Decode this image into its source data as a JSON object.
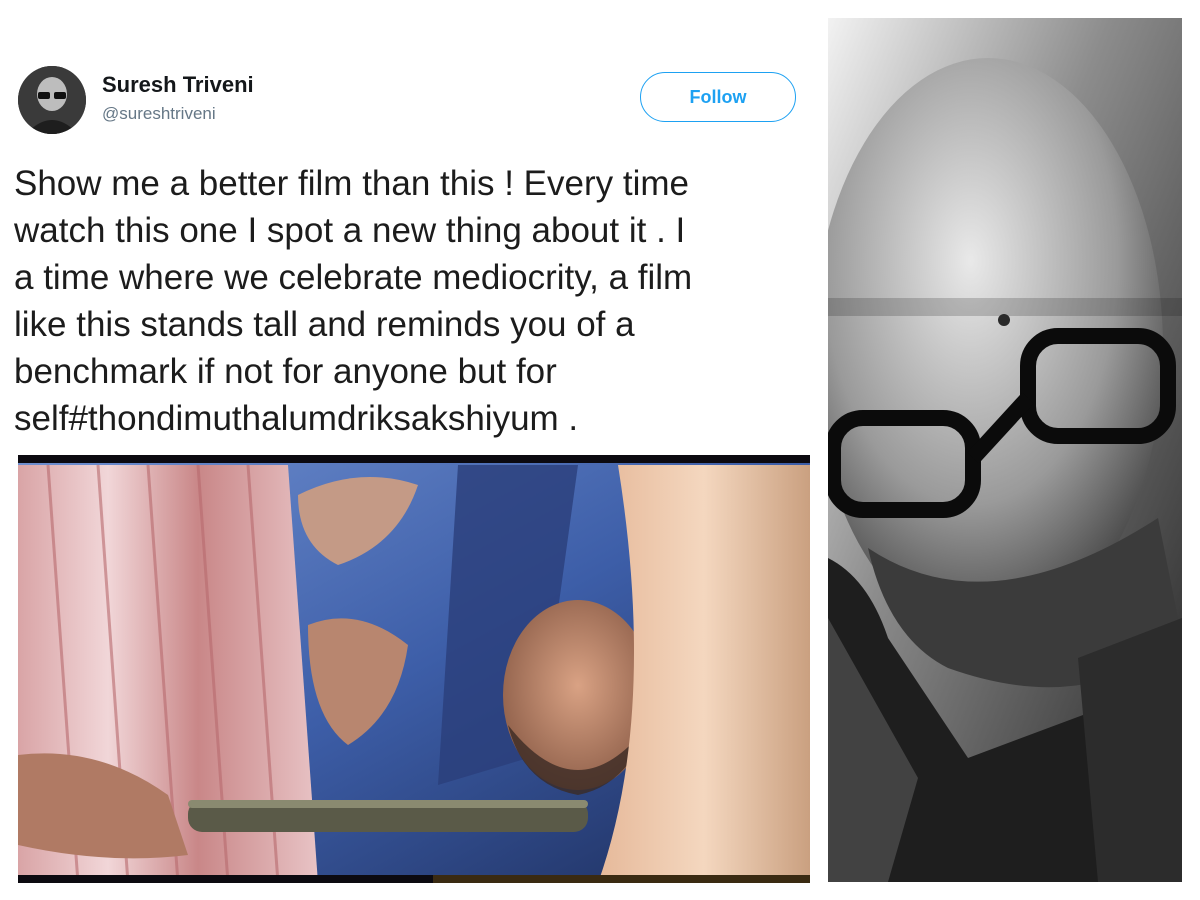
{
  "tweet": {
    "author_name": "Suresh Triveni",
    "author_handle": "@sureshtriveni",
    "follow_label": "Follow",
    "text_lines": [
      "Show me a better film than this ! Every time",
      "watch this one I spot a new thing about it . I",
      "a time where we celebrate mediocrity, a film",
      "like this stands tall and reminds you of a",
      "benchmark if not for anyone but for",
      "self#thondimuthalumdriksakshiyum ."
    ]
  },
  "colors": {
    "accent": "#1da1f2",
    "name_text": "#14171a",
    "handle_text": "#657786"
  },
  "icons": {
    "avatar": "profile-avatar-photo"
  }
}
